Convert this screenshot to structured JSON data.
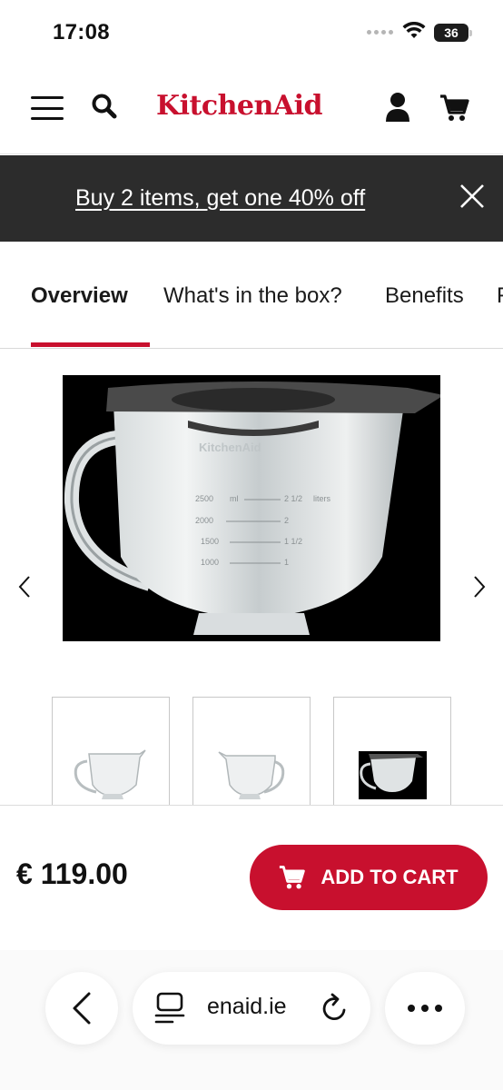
{
  "status": {
    "time": "17:08",
    "battery": "36"
  },
  "header": {
    "logo": "KitchenAid"
  },
  "promo": {
    "text": "Buy 2 items, get one 40% off"
  },
  "tabs": [
    {
      "label": "Overview",
      "active": true
    },
    {
      "label": "What's in the box?",
      "active": false
    },
    {
      "label": "Benefits",
      "active": false
    },
    {
      "label": "F",
      "active": false
    }
  ],
  "product": {
    "image_labels": {
      "brand": "KitchenAid",
      "marks": [
        "2500",
        "ml",
        "2 1/2",
        "liters",
        "2000",
        "2",
        "1500",
        "1 1/2",
        "1000",
        "1"
      ]
    },
    "thumbnails": 3,
    "selected_thumbnail": 3
  },
  "buy_bar": {
    "price": "€ 119.00",
    "add_to_cart": "ADD TO CART"
  },
  "browser": {
    "url": "enaid.ie"
  },
  "colors": {
    "brand": "#c8102e",
    "banner": "#2c2c2c"
  }
}
